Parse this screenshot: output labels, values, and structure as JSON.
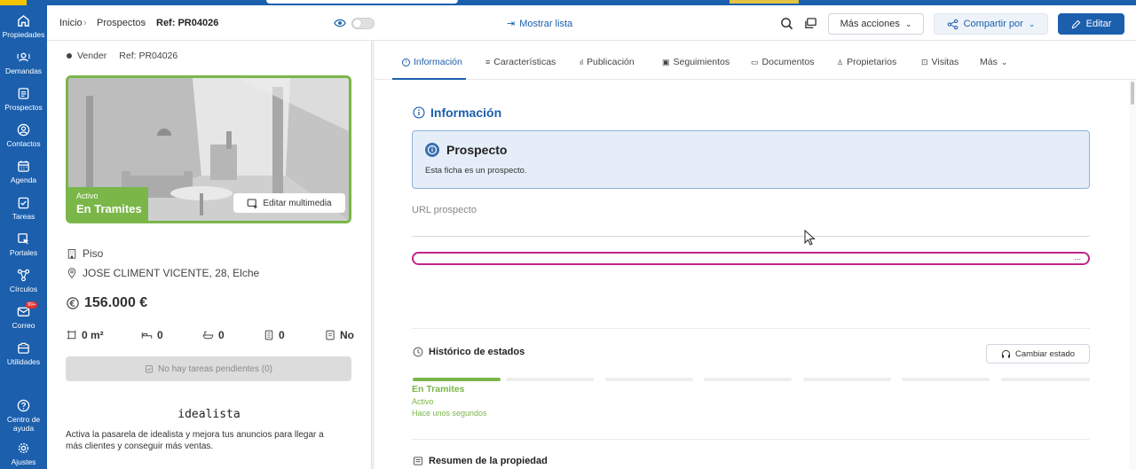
{
  "sidebar": {
    "items": [
      {
        "label": "Propiedades",
        "icon": "home-icon"
      },
      {
        "label": "Demandas",
        "icon": "demand-icon"
      },
      {
        "label": "Prospectos",
        "icon": "prospect-icon"
      },
      {
        "label": "Contactos",
        "icon": "contact-icon"
      },
      {
        "label": "Agenda",
        "icon": "calendar-icon"
      },
      {
        "label": "Tareas",
        "icon": "tasks-icon"
      },
      {
        "label": "Portales",
        "icon": "portals-icon"
      },
      {
        "label": "Círculos",
        "icon": "circles-icon"
      },
      {
        "label": "Correo",
        "icon": "mail-icon",
        "badge": "99+"
      },
      {
        "label": "Utilidades",
        "icon": "utilities-icon"
      }
    ],
    "bottom": [
      {
        "label": "Centro de ayuda",
        "icon": "help-icon"
      },
      {
        "label": "Ajustes",
        "icon": "settings-icon"
      }
    ]
  },
  "header": {
    "breadcrumb": [
      "Inicio",
      "Prospectos",
      "Ref: PR04026"
    ],
    "show_list": "Mostrar lista",
    "more_actions": "Más acciones",
    "share": "Compartir por",
    "edit": "Editar"
  },
  "property": {
    "operation": "Vender",
    "ref": "Ref: PR04026",
    "status_small": "Activo",
    "status_big": "En Tramites",
    "edit_media": "Editar multimedia",
    "type": "Piso",
    "address": "JOSE CLIMENT VICENTE, 28, Elche",
    "price": "156.000 €",
    "area": "0 m²",
    "bedrooms": "0",
    "bathrooms": "0",
    "floor": "0",
    "extra": "No",
    "tasks": "No hay tareas pendientes (0)",
    "portal_name": "idealista",
    "portal_text": "Activa la pasarela de idealista y mejora tus anuncios para llegar a más clientes y conseguir más ventas."
  },
  "tabs": [
    "Información",
    "Características",
    "Publicación",
    "Seguimientos",
    "Documentos",
    "Propietarios",
    "Visitas",
    "Más"
  ],
  "info": {
    "title": "Información",
    "prospect_title": "Prospecto",
    "prospect_text": "Esta ficha es un prospecto.",
    "url_label": "URL prospecto",
    "url_dots": "..."
  },
  "history": {
    "title": "Histórico de estados",
    "change_button": "Cambiar estado",
    "state": "En Tramites",
    "substate": "Activo",
    "time": "Hace unos segundos"
  },
  "summary": {
    "title": "Resumen de la propiedad"
  },
  "colors": {
    "primary": "#1b5fad",
    "green": "#7ab648",
    "magenta": "#c0268a"
  }
}
